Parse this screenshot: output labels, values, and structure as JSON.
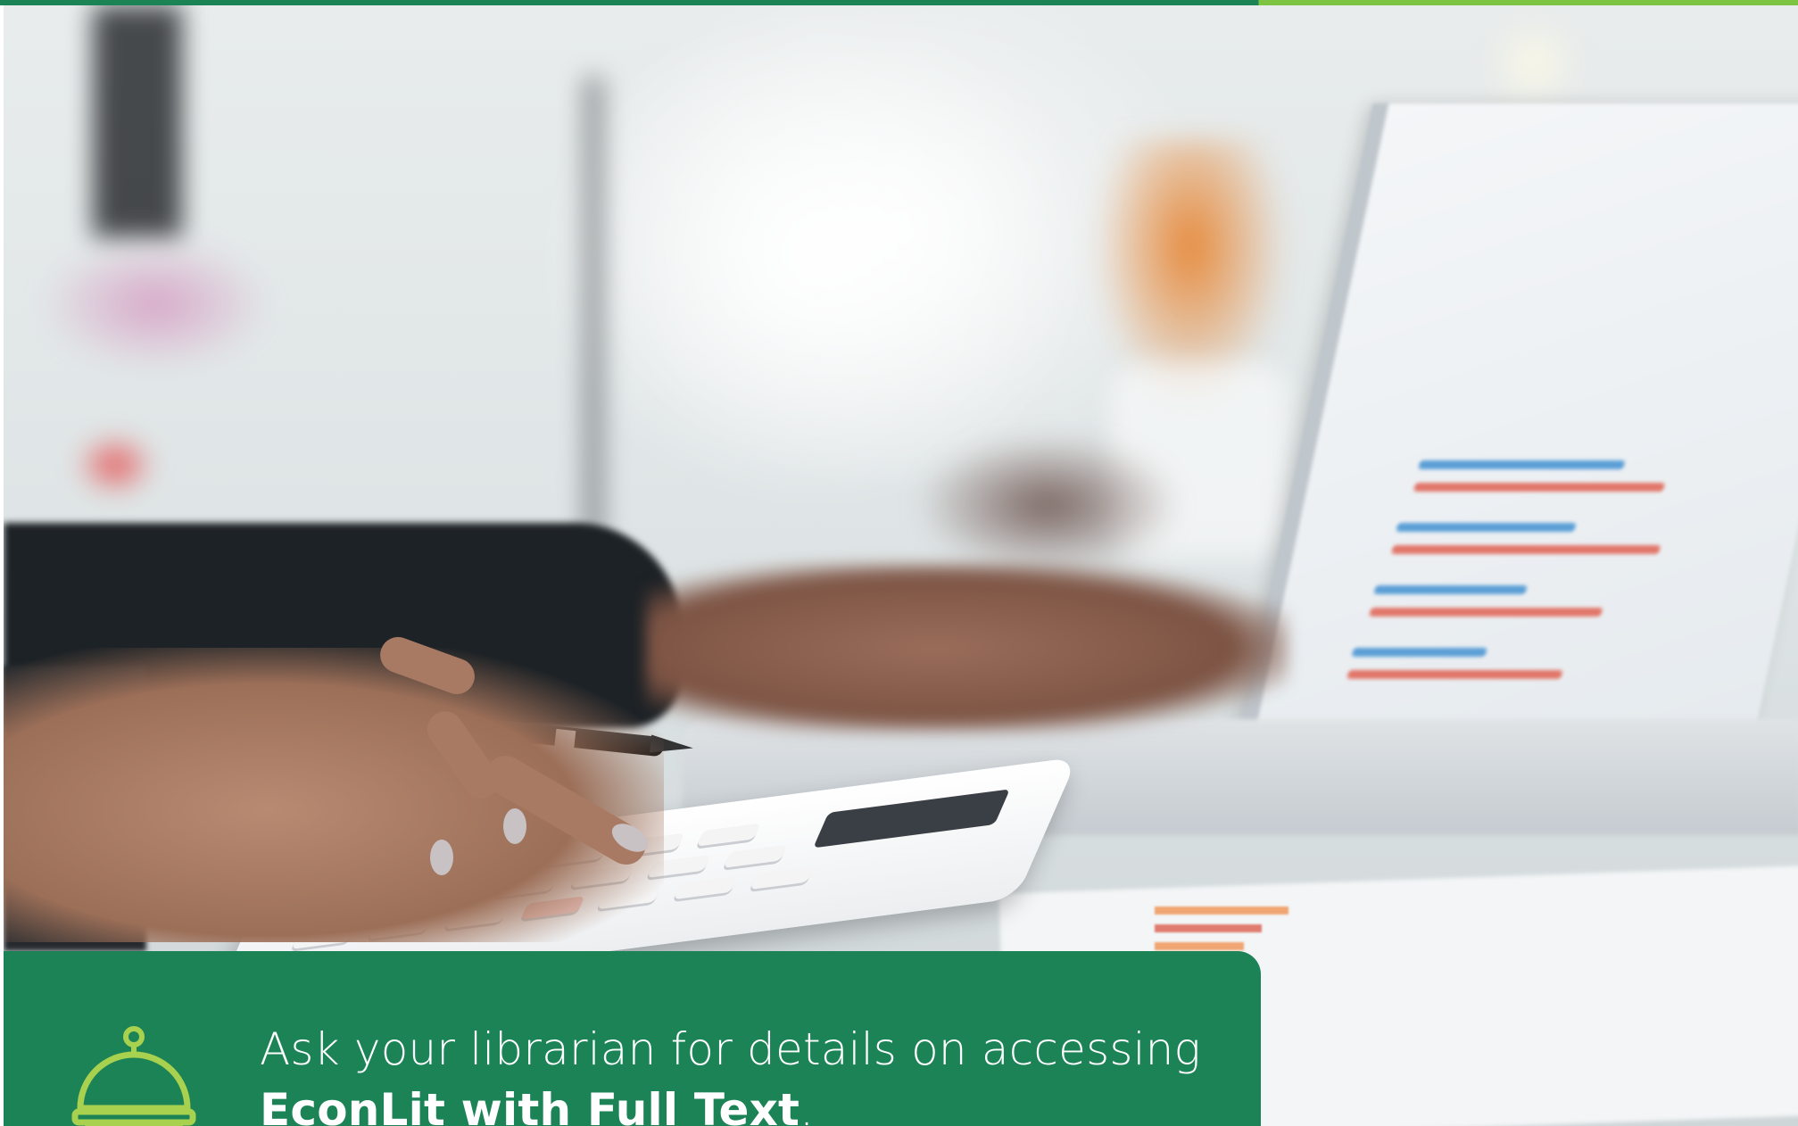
{
  "banner": {
    "line1": "Ask your librarian for details on accessing",
    "product": "EconLit with Full Text",
    "suffix": ".",
    "icon": "concierge-bell-icon"
  },
  "colors": {
    "brand_green": "#1b8356",
    "accent_lime": "#7cc442",
    "icon_lime": "#a8d14f"
  },
  "photo": {
    "subject": "hands-using-calculator-and-laptop"
  }
}
